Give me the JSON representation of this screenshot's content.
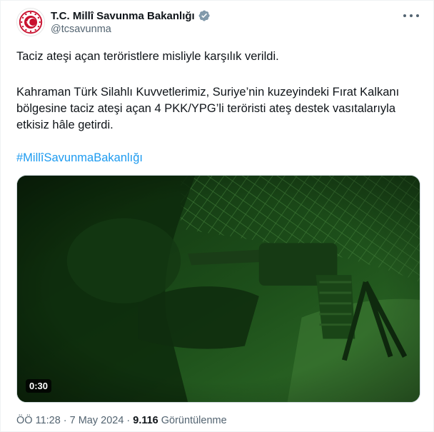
{
  "author": {
    "display_name": "T.C. Millî Savunma Bakanlığı",
    "handle": "@tcsavunma",
    "verified": true,
    "avatar_icon": "ministry-emblem-icon",
    "verified_icon": "verified-badge-icon",
    "badge_color": "#829aab"
  },
  "tweet": {
    "paragraph_1": "Taciz ateşi açan teröristlere misliyle karşılık verildi.",
    "paragraph_2": "Kahraman Türk Silahlı Kuvvetlerimiz, Suriye’nin kuzeyindeki Fırat Kalkanı bölgesine taciz ateşi açan 4 PKK/YPG’li teröristi ateş destek vasıtalarıyla etkisiz hâle getirdi.",
    "hashtag": "#MillîSavunmaBakanlığı"
  },
  "media": {
    "type": "video",
    "duration": "0:30",
    "tint_color": "#1f5a1c"
  },
  "meta": {
    "time": "ÖÖ 11:28",
    "separator": "·",
    "date": "7 May 2024",
    "views_count": "9.116",
    "views_label": "Görüntülenme"
  },
  "colors": {
    "text": "#0f1419",
    "secondary": "#536471",
    "link": "#1d9bf0",
    "emblem_red": "#c8102e"
  }
}
